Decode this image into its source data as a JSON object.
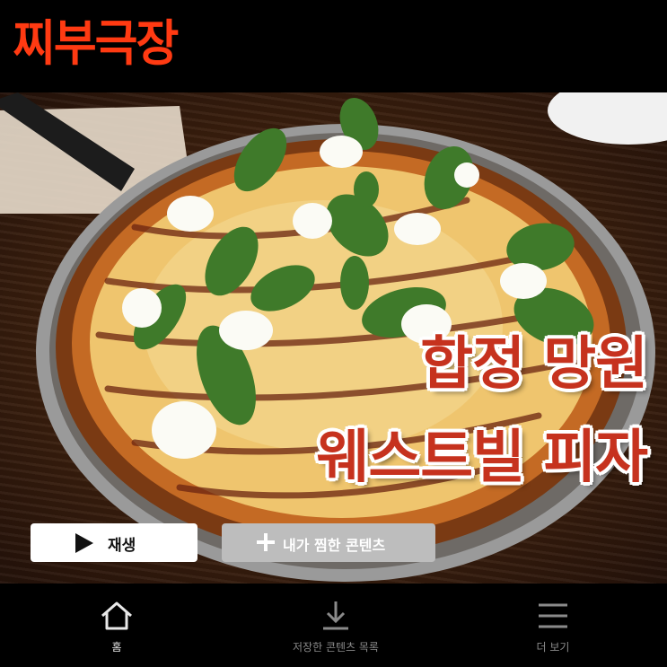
{
  "header": {
    "brand": "찌부극장"
  },
  "hero": {
    "title_line1": "합정 망원",
    "title_line2": "웨스트빌 피자"
  },
  "actions": {
    "play_label": "재생",
    "mylist_label": "내가 찜한 콘텐츠"
  },
  "bottom_nav": {
    "items": [
      {
        "label": "홈",
        "icon": "home-icon",
        "active": true
      },
      {
        "label": "저장한 콘텐츠 목록",
        "icon": "download-icon",
        "active": false
      },
      {
        "label": "더 보기",
        "icon": "menu-icon",
        "active": false
      }
    ]
  },
  "colors": {
    "brand": "#ff3a12",
    "title": "#c6321e",
    "mylist_button": "#bdbdbd"
  }
}
